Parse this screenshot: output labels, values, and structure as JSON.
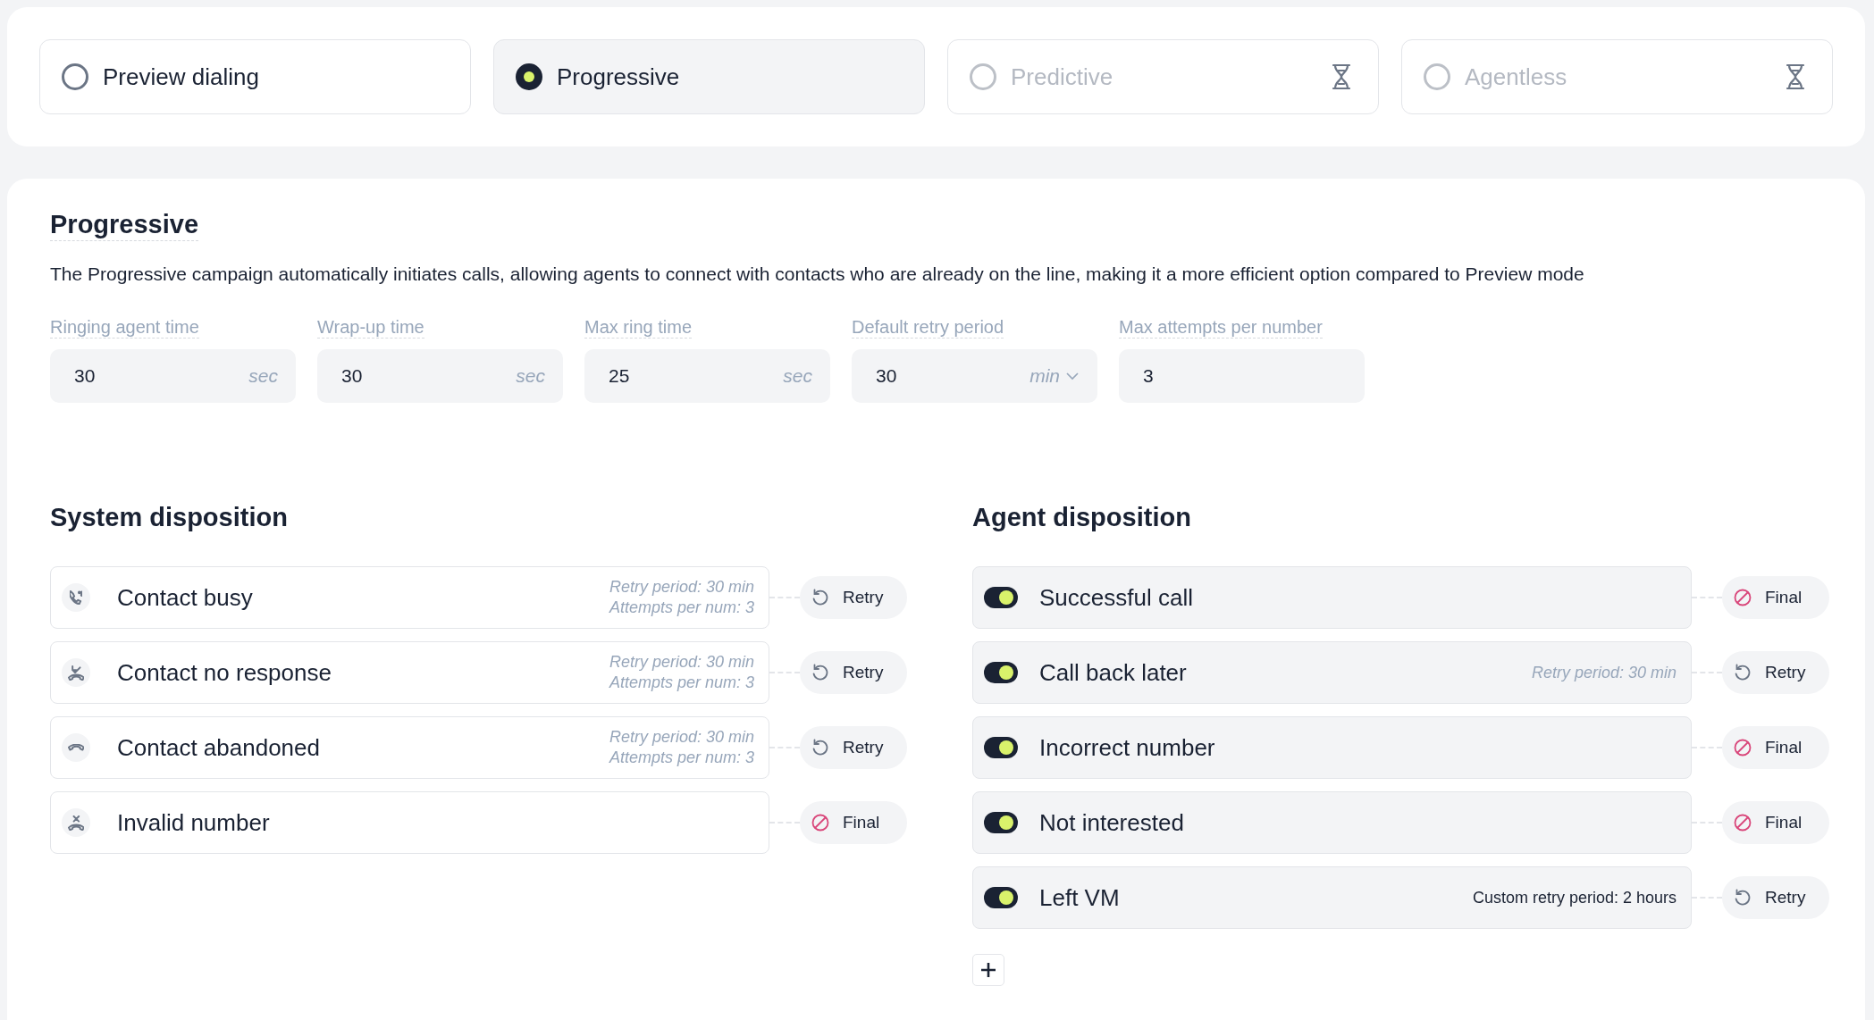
{
  "modes": [
    {
      "label": "Preview dialing",
      "selected": false,
      "locked": false
    },
    {
      "label": "Progressive",
      "selected": true,
      "locked": false
    },
    {
      "label": "Predictive",
      "selected": false,
      "locked": true
    },
    {
      "label": "Agentless",
      "selected": false,
      "locked": true
    }
  ],
  "settings": {
    "title": "Progressive",
    "description": "The Progressive campaign automatically initiates calls, allowing agents to connect with contacts who are already on the line, making it a more efficient option compared to Preview mode",
    "fields": [
      {
        "kind": "number",
        "label": "Ringing agent time",
        "value": "30",
        "unit": "sec"
      },
      {
        "kind": "number",
        "label": "Wrap-up time",
        "value": "30",
        "unit": "sec"
      },
      {
        "kind": "number",
        "label": "Max ring time",
        "value": "25",
        "unit": "sec"
      },
      {
        "kind": "select",
        "label": "Default retry period",
        "value": "30",
        "unit": "min"
      },
      {
        "kind": "number",
        "label": "Max attempts per number",
        "value": "3"
      }
    ]
  },
  "system_disposition": {
    "title": "System disposition",
    "items": [
      {
        "kind": "busy",
        "label": "Contact busy",
        "details": [
          "Retry period: 30 min",
          "Attempts per num: 3"
        ],
        "outcome": {
          "kind": "retry",
          "label": "Retry"
        }
      },
      {
        "kind": "no_response",
        "label": "Contact no response",
        "details": [
          "Retry period: 30 min",
          "Attempts per num: 3"
        ],
        "outcome": {
          "kind": "retry",
          "label": "Retry"
        }
      },
      {
        "kind": "abandoned",
        "label": "Contact abandoned",
        "details": [
          "Retry period: 30 min",
          "Attempts per num: 3"
        ],
        "outcome": {
          "kind": "retry",
          "label": "Retry"
        }
      },
      {
        "kind": "invalid",
        "label": "Invalid number",
        "outcome": {
          "kind": "final",
          "label": "Final"
        }
      }
    ]
  },
  "agent_disposition": {
    "title": "Agent disposition",
    "items": [
      {
        "label": "Successful call",
        "on": true,
        "outcome": {
          "kind": "final",
          "label": "Final"
        }
      },
      {
        "label": "Call back later",
        "on": true,
        "note": {
          "kind": "default",
          "text": "Retry period: 30 min"
        },
        "outcome": {
          "kind": "retry",
          "label": "Retry"
        }
      },
      {
        "label": "Incorrect number",
        "on": true,
        "outcome": {
          "kind": "final",
          "label": "Final"
        }
      },
      {
        "label": "Not interested",
        "on": true,
        "outcome": {
          "kind": "final",
          "label": "Final"
        }
      },
      {
        "label": "Left VM",
        "on": true,
        "note": {
          "kind": "custom",
          "text": "Custom retry period: 2 hours"
        },
        "outcome": {
          "kind": "retry",
          "label": "Retry"
        }
      }
    ]
  }
}
